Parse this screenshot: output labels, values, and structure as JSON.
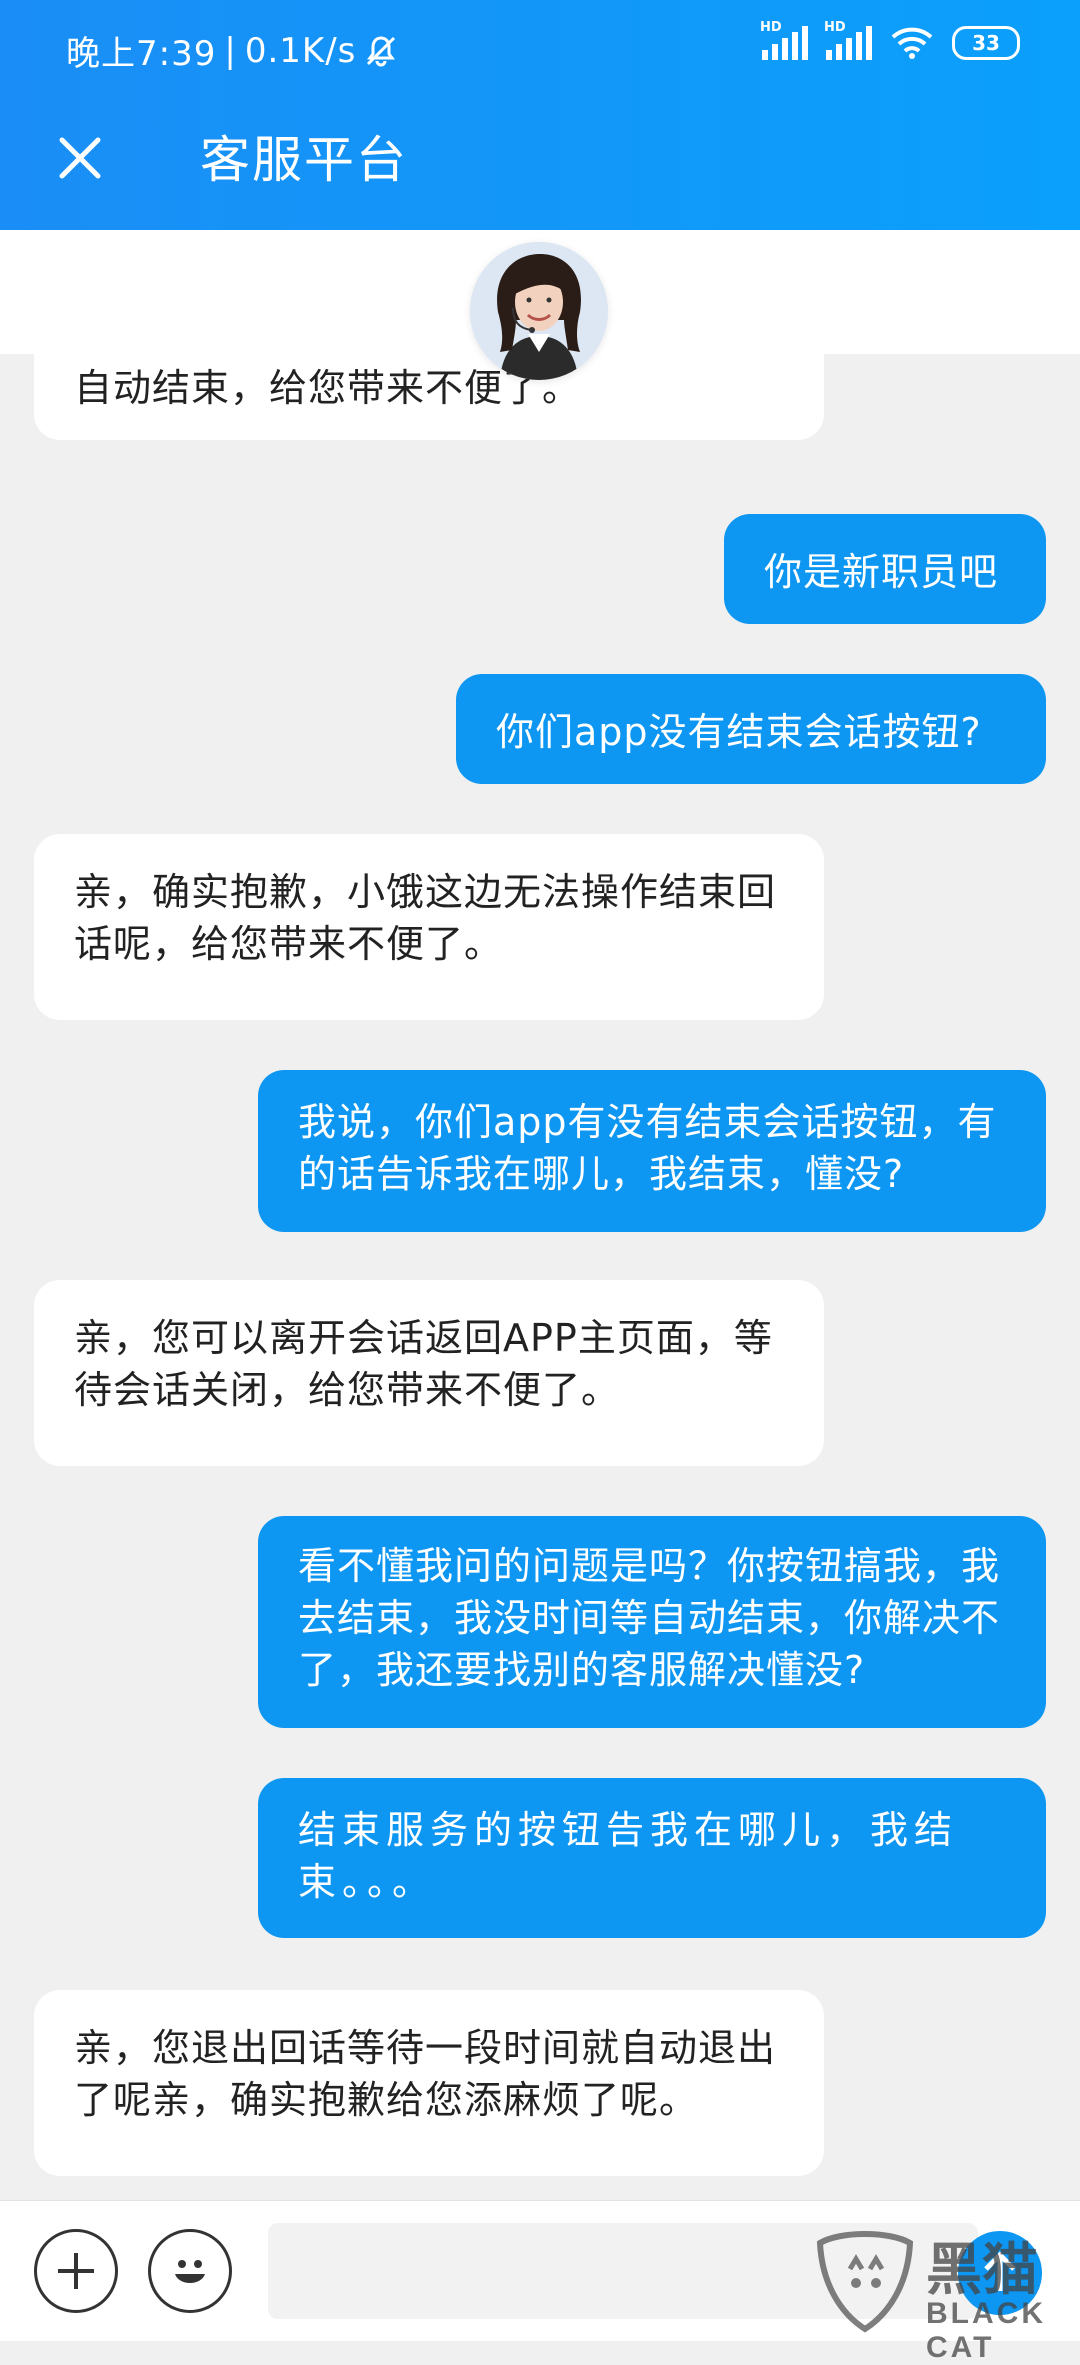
{
  "status_bar": {
    "time": "晚上7:39",
    "speed": "0.1K/s",
    "signal_label_1": "HD",
    "signal_label_2": "HD",
    "battery": "33",
    "icons": [
      "mute-bell-icon",
      "signal-icon",
      "signal-icon",
      "wifi-icon",
      "battery-icon"
    ]
  },
  "header": {
    "title": "客服平台",
    "close_icon": "close-icon"
  },
  "colors": {
    "header": "#1a8ef6",
    "user_bubble": "#0d96f2",
    "agent_bubble": "#ffffff",
    "background": "#f0f0f0"
  },
  "messages": [
    {
      "side": "agent",
      "text": "自动结束，给您带来不便了。"
    },
    {
      "side": "user",
      "text": "你是新职员吧"
    },
    {
      "side": "user",
      "text": "你们app没有结束会话按钮?"
    },
    {
      "side": "agent",
      "text": "亲，确实抱歉，小饿这边无法操作结束回话呢，给您带来不便了。"
    },
    {
      "side": "user",
      "text": "我说，你们app有没有结束会话按钮，有的话告诉我在哪儿，我结束，懂没?"
    },
    {
      "side": "agent",
      "text": "亲，您可以离开会话返回APP主页面，等待会话关闭，给您带来不便了。"
    },
    {
      "side": "user",
      "text": "看不懂我问的问题是吗？你按钮搞我，我去结束，我没时间等自动结束，你解决不了，我还要找别的客服解决懂没?"
    },
    {
      "side": "user",
      "text": "结束服务的按钮告我在哪儿，我结束。。。"
    },
    {
      "side": "agent",
      "text": "亲，您退出回话等待一段时间就自动退出了呢亲，确实抱歉给您添麻烦了呢。"
    }
  ],
  "input_bar": {
    "add_icon": "plus-icon",
    "emoji_icon": "smiley-icon",
    "placeholder": "",
    "send_icon": "send-arrow-icon"
  },
  "watermark": {
    "brand": "黑猫",
    "text": "BLACK CAT"
  }
}
